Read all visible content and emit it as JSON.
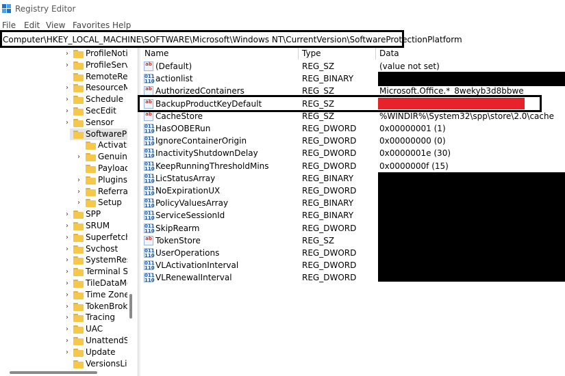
{
  "window": {
    "title": "Registry Editor"
  },
  "menu": [
    "File",
    "Edit",
    "View",
    "Favorites",
    "Help"
  ],
  "address": {
    "path": "Computer\\HKEY_LOCAL_MACHINE\\SOFTWARE\\Microsoft\\Windows NT\\CurrentVersion\\SoftwareProtectionPlatform"
  },
  "tree": [
    {
      "label": "ProfileNotif",
      "depth": 0,
      "expand": "collapsed"
    },
    {
      "label": "ProfileServic",
      "depth": 0,
      "expand": "collapsed"
    },
    {
      "label": "RemoteReg",
      "depth": 0,
      "expand": "none"
    },
    {
      "label": "ResourceMa",
      "depth": 0,
      "expand": "collapsed"
    },
    {
      "label": "Schedule",
      "depth": 0,
      "expand": "collapsed"
    },
    {
      "label": "SecEdit",
      "depth": 0,
      "expand": "collapsed"
    },
    {
      "label": "Sensor",
      "depth": 0,
      "expand": "collapsed"
    },
    {
      "label": "SoftwarePro",
      "depth": 0,
      "expand": "expanded",
      "selected": true
    },
    {
      "label": "Activatio",
      "depth": 1,
      "expand": "none"
    },
    {
      "label": "Genuine",
      "depth": 1,
      "expand": "collapsed"
    },
    {
      "label": "PayloadO",
      "depth": 1,
      "expand": "none"
    },
    {
      "label": "Plugins",
      "depth": 1,
      "expand": "collapsed"
    },
    {
      "label": "ReferralD",
      "depth": 1,
      "expand": "collapsed"
    },
    {
      "label": "Setup",
      "depth": 1,
      "expand": "collapsed"
    },
    {
      "label": "SPP",
      "depth": 0,
      "expand": "collapsed"
    },
    {
      "label": "SRUM",
      "depth": 0,
      "expand": "collapsed"
    },
    {
      "label": "Superfetch",
      "depth": 0,
      "expand": "collapsed"
    },
    {
      "label": "Svchost",
      "depth": 0,
      "expand": "collapsed"
    },
    {
      "label": "SystemResto",
      "depth": 0,
      "expand": "collapsed"
    },
    {
      "label": "Terminal Se",
      "depth": 0,
      "expand": "collapsed"
    },
    {
      "label": "TileDataMo",
      "depth": 0,
      "expand": "collapsed"
    },
    {
      "label": "Time Zones",
      "depth": 0,
      "expand": "collapsed"
    },
    {
      "label": "TokenBroke",
      "depth": 0,
      "expand": "collapsed"
    },
    {
      "label": "Tracing",
      "depth": 0,
      "expand": "collapsed"
    },
    {
      "label": "UAC",
      "depth": 0,
      "expand": "collapsed"
    },
    {
      "label": "UnattendSe",
      "depth": 0,
      "expand": "collapsed"
    },
    {
      "label": "Update",
      "depth": 0,
      "expand": "collapsed"
    },
    {
      "label": "VersionsList",
      "depth": 0,
      "expand": "none"
    }
  ],
  "columns": {
    "name": "Name",
    "type": "Type",
    "data": "Data"
  },
  "values": [
    {
      "name": "(Default)",
      "type": "REG_SZ",
      "data": "(value not set)",
      "kind": "sz"
    },
    {
      "name": "actionlist",
      "type": "REG_BINARY",
      "data": "",
      "kind": "bin"
    },
    {
      "name": "AuthorizedContainers",
      "type": "REG_SZ",
      "data": "Microsoft.Office.*_8wekyb3d8bbwe",
      "kind": "sz"
    },
    {
      "name": "BackupProductKeyDefault",
      "type": "REG_SZ",
      "data": "",
      "kind": "sz"
    },
    {
      "name": "CacheStore",
      "type": "REG_SZ",
      "data": "%WINDIR%\\System32\\spp\\store\\2.0\\cache",
      "kind": "sz"
    },
    {
      "name": "HasOOBERun",
      "type": "REG_DWORD",
      "data": "0x00000001 (1)",
      "kind": "bin"
    },
    {
      "name": "IgnoreContainerOrigin",
      "type": "REG_DWORD",
      "data": "0x00000000 (0)",
      "kind": "bin"
    },
    {
      "name": "InactivityShutdownDelay",
      "type": "REG_DWORD",
      "data": "0x0000001e (30)",
      "kind": "bin"
    },
    {
      "name": "KeepRunningThresholdMins",
      "type": "REG_DWORD",
      "data": "0x0000000f (15)",
      "kind": "bin"
    },
    {
      "name": "LicStatusArray",
      "type": "REG_BINARY",
      "data": "",
      "kind": "bin"
    },
    {
      "name": "NoExpirationUX",
      "type": "REG_DWORD",
      "data": "",
      "kind": "bin"
    },
    {
      "name": "PolicyValuesArray",
      "type": "REG_BINARY",
      "data": "",
      "kind": "bin"
    },
    {
      "name": "ServiceSessionId",
      "type": "REG_BINARY",
      "data": "",
      "kind": "bin"
    },
    {
      "name": "SkipRearm",
      "type": "REG_DWORD",
      "data": "",
      "kind": "bin"
    },
    {
      "name": "TokenStore",
      "type": "REG_SZ",
      "data": "",
      "kind": "sz"
    },
    {
      "name": "UserOperations",
      "type": "REG_DWORD",
      "data": "",
      "kind": "bin"
    },
    {
      "name": "VLActivationInterval",
      "type": "REG_DWORD",
      "data": "",
      "kind": "bin"
    },
    {
      "name": "VLRenewalInterval",
      "type": "REG_DWORD",
      "data": "",
      "kind": "bin"
    }
  ],
  "icons": {
    "sz": "ab",
    "bin": "011\n110"
  },
  "colors": {
    "folder": "#f5c84c",
    "redaction": "#000000",
    "redaction_red": "#e8222a"
  }
}
